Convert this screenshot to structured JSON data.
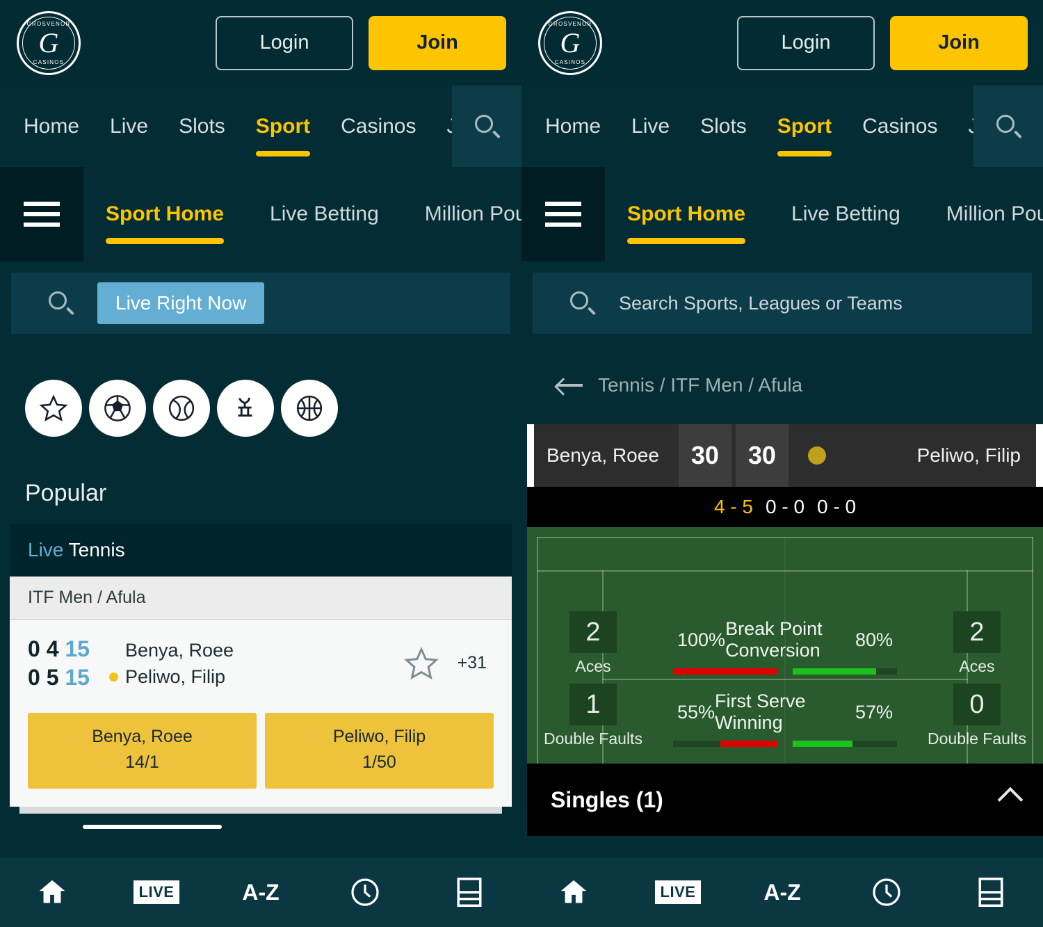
{
  "brand": {
    "logo_top": "GROSVENOR",
    "logo_letter": "G",
    "logo_bottom": "CASINOS",
    "accent_yellow": "#fdc500",
    "accent_blue": "#64aed4",
    "bg_teal": "#032c35"
  },
  "header": {
    "login_label": "Login",
    "join_label": "Join",
    "nav": [
      {
        "label": "Home",
        "active": false
      },
      {
        "label": "Live",
        "active": false
      },
      {
        "label": "Slots",
        "active": false
      },
      {
        "label": "Sport",
        "active": true
      },
      {
        "label": "Casinos",
        "active": false
      },
      {
        "label": "J",
        "active": false
      }
    ],
    "search_icon": "search-icon"
  },
  "subnav": {
    "menu_icon": "hamburger-menu-icon",
    "items": [
      {
        "label": "Sport Home",
        "active": true
      },
      {
        "label": "Live Betting",
        "active": false
      },
      {
        "label": "Million Pou",
        "active": false
      }
    ]
  },
  "left": {
    "search": {
      "icon": "search-icon",
      "chip_label": "Live Right Now"
    },
    "sport_icons": [
      {
        "name": "star-icon"
      },
      {
        "name": "football-icon"
      },
      {
        "name": "tennis-ball-icon"
      },
      {
        "name": "horse-racing-icon"
      },
      {
        "name": "basketball-icon"
      }
    ],
    "popular_title": "Popular",
    "card": {
      "live_label": "Live",
      "sport_label": "Tennis",
      "league": "ITF Men / Afula",
      "rows": [
        {
          "sets": "0",
          "games": "4",
          "points": "15",
          "player": "Benya, Roee",
          "serving": false
        },
        {
          "sets": "0",
          "games": "5",
          "points": "15",
          "player": "Peliwo, Filip",
          "serving": true
        }
      ],
      "favourite_icon": "star-outline-icon",
      "more_markets": "+31",
      "odds": [
        {
          "selection": "Benya, Roee",
          "price": "14/1"
        },
        {
          "selection": "Peliwo, Filip",
          "price": "1/50"
        }
      ]
    }
  },
  "right": {
    "search": {
      "icon": "search-icon",
      "placeholder": "Search Sports, Leagues or Teams"
    },
    "breadcrumb": {
      "back_icon": "back-arrow-icon",
      "path": "Tennis / ITF Men / Afula"
    },
    "scoreboard": {
      "home_player": "Benya, Roee",
      "away_player": "Peliwo, Filip",
      "home_points": "30",
      "away_points": "30",
      "serve_indicator": "serve-dot-icon",
      "sets": [
        {
          "value": "4 - 5",
          "current": true
        },
        {
          "value": "0 - 0",
          "current": false
        },
        {
          "value": "0 - 0",
          "current": false
        }
      ]
    },
    "stats": {
      "rows": [
        {
          "label": "Break Point Conversion",
          "home_pct": "100%",
          "away_pct": "80%",
          "home_fill": 100,
          "away_fill": 80,
          "home_side_value": "2",
          "home_side_caption": "Aces",
          "away_side_value": "2",
          "away_side_caption": "Aces"
        },
        {
          "label": "First Serve Winning",
          "home_pct": "55%",
          "away_pct": "57%",
          "home_fill": 55,
          "away_fill": 57,
          "home_side_value": "1",
          "home_side_caption": "Double Faults",
          "away_side_value": "0",
          "away_side_caption": "Double Faults"
        }
      ]
    },
    "markets": {
      "singles_label": "Singles (1)",
      "collapse_icon": "chevron-up-icon"
    }
  },
  "bottomnav": [
    {
      "name": "home-icon",
      "label": ""
    },
    {
      "name": "live-icon",
      "label": "LIVE"
    },
    {
      "name": "a-to-z-icon",
      "label": "A-Z"
    },
    {
      "name": "clock-icon",
      "label": ""
    },
    {
      "name": "betslip-icon",
      "label": ""
    }
  ]
}
